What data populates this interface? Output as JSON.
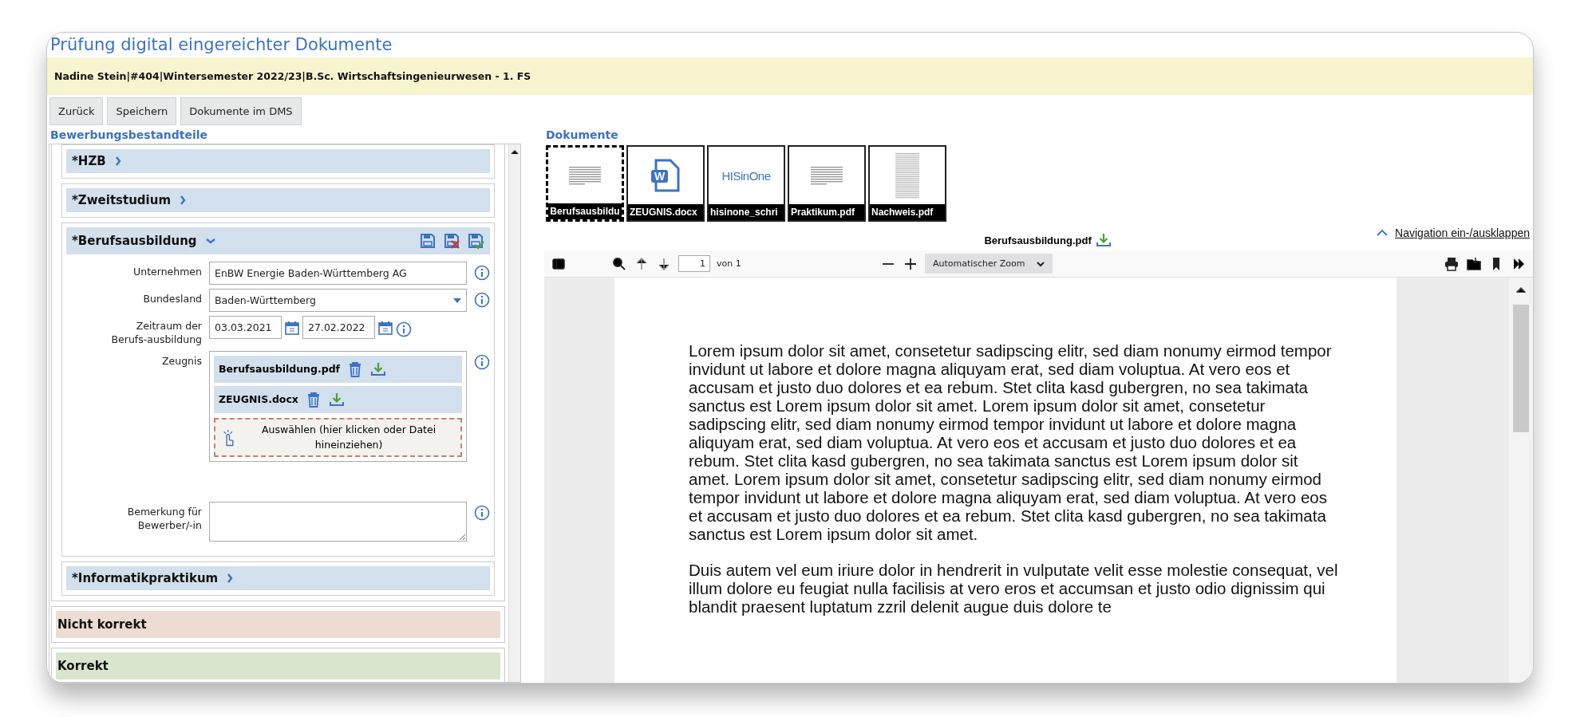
{
  "page_title": "Prüfung digital eingereichter Dokumente",
  "applicant_bar": "Nadine Stein|#404|Wintersemester 2022/23|B.Sc. Wirtschaftsingenieurwesen - 1. FS",
  "buttons": [
    "Zurück",
    "Speichern",
    "Dokumente im DMS"
  ],
  "left": {
    "heading": "Bewerbungsbestandteile",
    "sections": [
      {
        "title": "*HZB",
        "expanded": false
      },
      {
        "title": "*Zweitstudium",
        "expanded": false
      },
      {
        "title": "*Berufsausbildung",
        "expanded": true,
        "fields": [
          {
            "kind": "text",
            "label": "Unternehmen",
            "value": "EnBW Energie Baden-Württemberg AG"
          },
          {
            "kind": "select",
            "label": "Bundesland",
            "value": "Baden-Württemberg"
          },
          {
            "kind": "daterange",
            "label": "Zeitraum der Berufs-ausbildung",
            "from": "03.03.2021",
            "to": "27.02.2022"
          },
          {
            "kind": "files",
            "label": "Zeugnis",
            "files": [
              "Berufsausbildung.pdf",
              "ZEUGNIS.docx"
            ],
            "upload_hint": "Auswählen (hier klicken oder Datei hineinziehen)"
          },
          {
            "kind": "textarea",
            "label": "Bemerkung für Bewerber/-in"
          }
        ]
      },
      {
        "title": "*Informatikpraktikum",
        "expanded": false
      }
    ],
    "verdicts": [
      {
        "label": "Nicht korrekt",
        "color": "#eddcd1"
      },
      {
        "label": "Korrekt",
        "color": "#d9e5cc"
      }
    ]
  },
  "right": {
    "heading": "Dokumente",
    "thumbnails": [
      {
        "name": "Berufsausbildu",
        "kind": "text-page",
        "selected": true
      },
      {
        "name": "ZEUGNIS.docx",
        "kind": "word",
        "icon_letter": "W",
        "selected": false
      },
      {
        "name": "hisinone_schri",
        "kind": "logo",
        "logo_text": "HISinOne",
        "selected": false
      },
      {
        "name": "Praktikum.pdf",
        "kind": "text-page",
        "selected": false
      },
      {
        "name": "Nachweis.pdf",
        "kind": "dense-page",
        "selected": false
      }
    ],
    "file_name": "Berufsausbildung.pdf",
    "nav_link": "Navigation ein-/ausklappen",
    "toolbar": {
      "page": "1",
      "page_count": "von 1",
      "zoom": "Automatischer Zoom"
    },
    "paragraphs": [
      "Lorem ipsum dolor sit amet, consetetur sadipscing elitr, sed diam nonumy eirmod tempor invidunt ut labore et dolore magna aliquyam erat, sed diam voluptua. At vero eos et accusam et justo duo dolores et ea rebum. Stet clita kasd gubergren, no sea takimata sanctus est Lorem ipsum dolor sit amet. Lorem ipsum dolor sit amet, consetetur sadipscing elitr, sed diam nonumy eirmod tempor invidunt ut labore et dolore magna aliquyam erat, sed diam voluptua. At vero eos et accusam et justo duo dolores et ea rebum. Stet clita kasd gubergren, no sea takimata sanctus est Lorem ipsum dolor sit amet. Lorem ipsum dolor sit amet, consetetur sadipscing elitr, sed diam nonumy eirmod tempor invidunt ut labore et dolore magna aliquyam erat, sed diam voluptua. At vero eos et accusam et justo duo dolores et ea rebum. Stet clita kasd gubergren, no sea takimata sanctus est Lorem ipsum dolor sit amet.",
      "Duis autem vel eum iriure dolor in hendrerit in vulputate velit esse molestie consequat, vel illum dolore eu feugiat nulla facilisis at vero eros et accumsan et justo odio dignissim qui blandit praesent luptatum zzril delenit augue duis dolore te"
    ]
  }
}
